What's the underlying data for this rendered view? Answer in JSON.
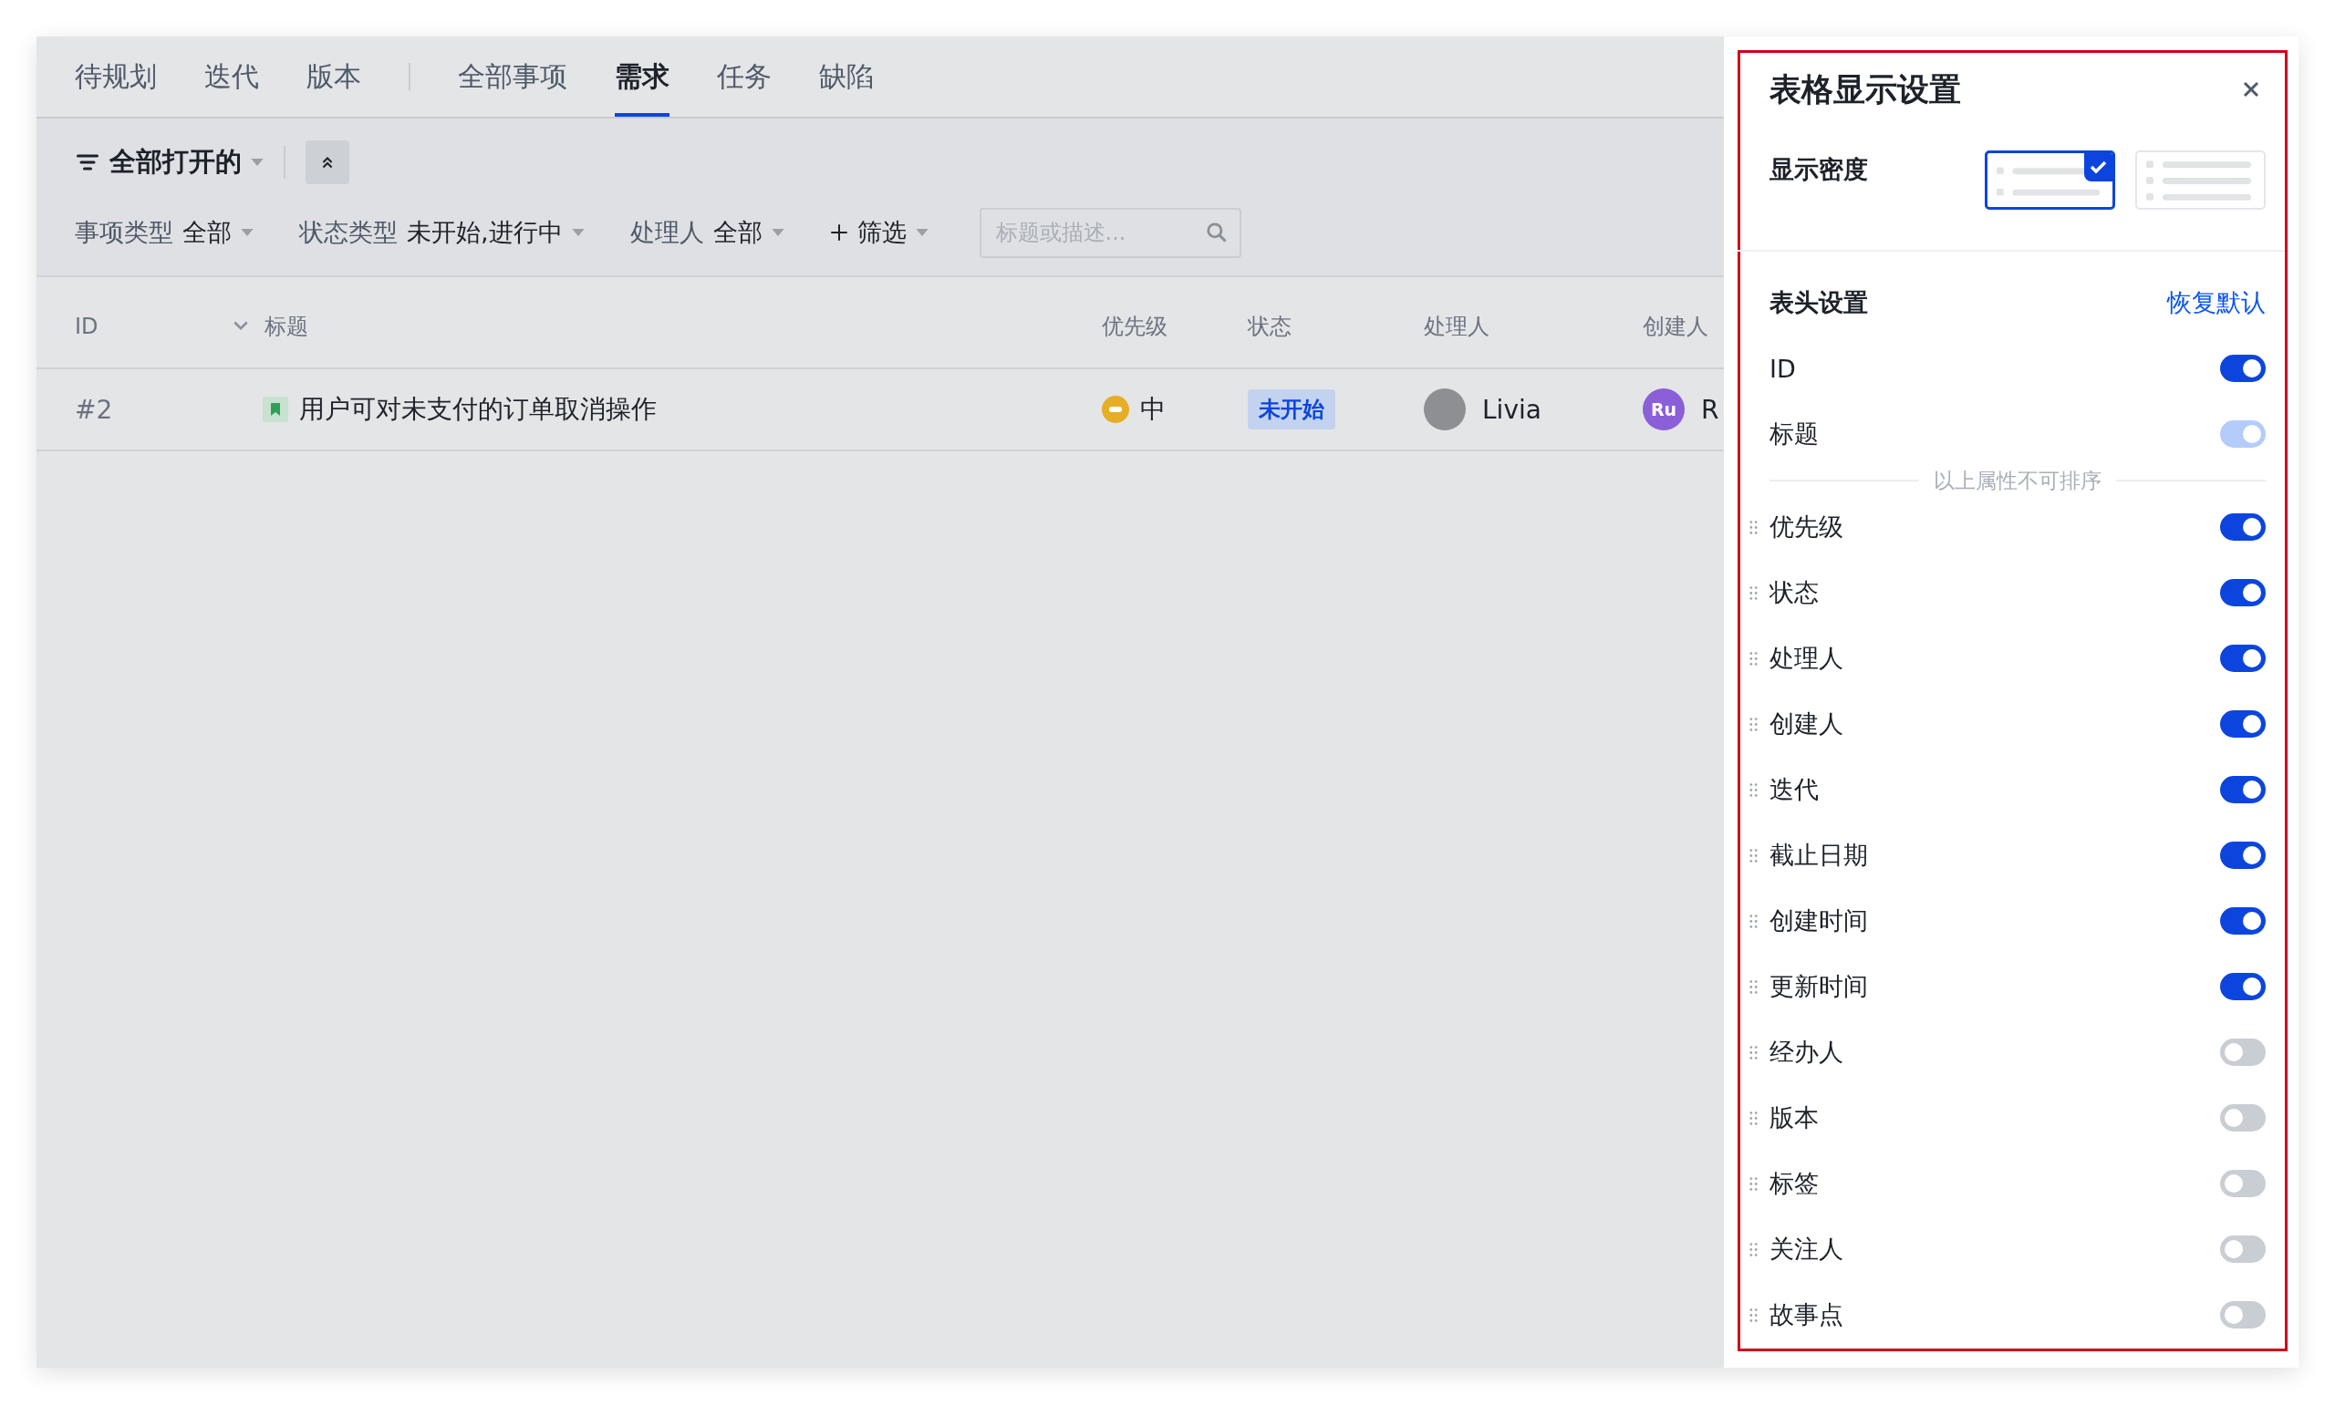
{
  "tab_groups": [
    {
      "tabs": [
        {
          "label": "待规划",
          "selected": false
        },
        {
          "label": "迭代",
          "selected": false
        },
        {
          "label": "版本",
          "selected": false
        }
      ]
    },
    {
      "tabs": [
        {
          "label": "全部事项",
          "selected": false
        },
        {
          "label": "需求",
          "selected": true
        },
        {
          "label": "任务",
          "selected": false
        },
        {
          "label": "缺陷",
          "selected": false
        }
      ]
    }
  ],
  "view": {
    "label": "全部打开的"
  },
  "filters": [
    {
      "label": "事项类型",
      "value": "全部"
    },
    {
      "label": "状态类型",
      "value": "未开始,进行中"
    },
    {
      "label": "处理人",
      "value": "全部"
    }
  ],
  "add_filter": {
    "label": "筛选"
  },
  "search": {
    "placeholder": "标题或描述..."
  },
  "table": {
    "columns": [
      "ID",
      "标题",
      "优先级",
      "状态",
      "处理人",
      "创建人"
    ],
    "rows": [
      {
        "id": "#2",
        "title": "用户可对未支付的订单取消操作",
        "priority": "中",
        "status": "未开始",
        "assignee": "Livia",
        "creator_initials": "Ru",
        "creator": "R"
      }
    ]
  },
  "settings_panel": {
    "title": "表格显示设置",
    "density": {
      "label": "显示密度",
      "options": [
        {
          "kind": "loose",
          "selected": true
        },
        {
          "kind": "compact",
          "selected": false
        }
      ]
    },
    "header": {
      "label": "表头设置",
      "reset": "恢复默认"
    },
    "fixed_columns": [
      {
        "label": "ID",
        "on": true,
        "disabled": false
      },
      {
        "label": "标题",
        "on": true,
        "disabled": true
      }
    ],
    "divider_note": "以上属性不可排序",
    "columns": [
      {
        "label": "优先级",
        "on": true
      },
      {
        "label": "状态",
        "on": true
      },
      {
        "label": "处理人",
        "on": true
      },
      {
        "label": "创建人",
        "on": true
      },
      {
        "label": "迭代",
        "on": true
      },
      {
        "label": "截止日期",
        "on": true
      },
      {
        "label": "创建时间",
        "on": true
      },
      {
        "label": "更新时间",
        "on": true
      },
      {
        "label": "经办人",
        "on": false
      },
      {
        "label": "版本",
        "on": false
      },
      {
        "label": "标签",
        "on": false
      },
      {
        "label": "关注人",
        "on": false
      },
      {
        "label": "故事点",
        "on": false
      }
    ]
  }
}
